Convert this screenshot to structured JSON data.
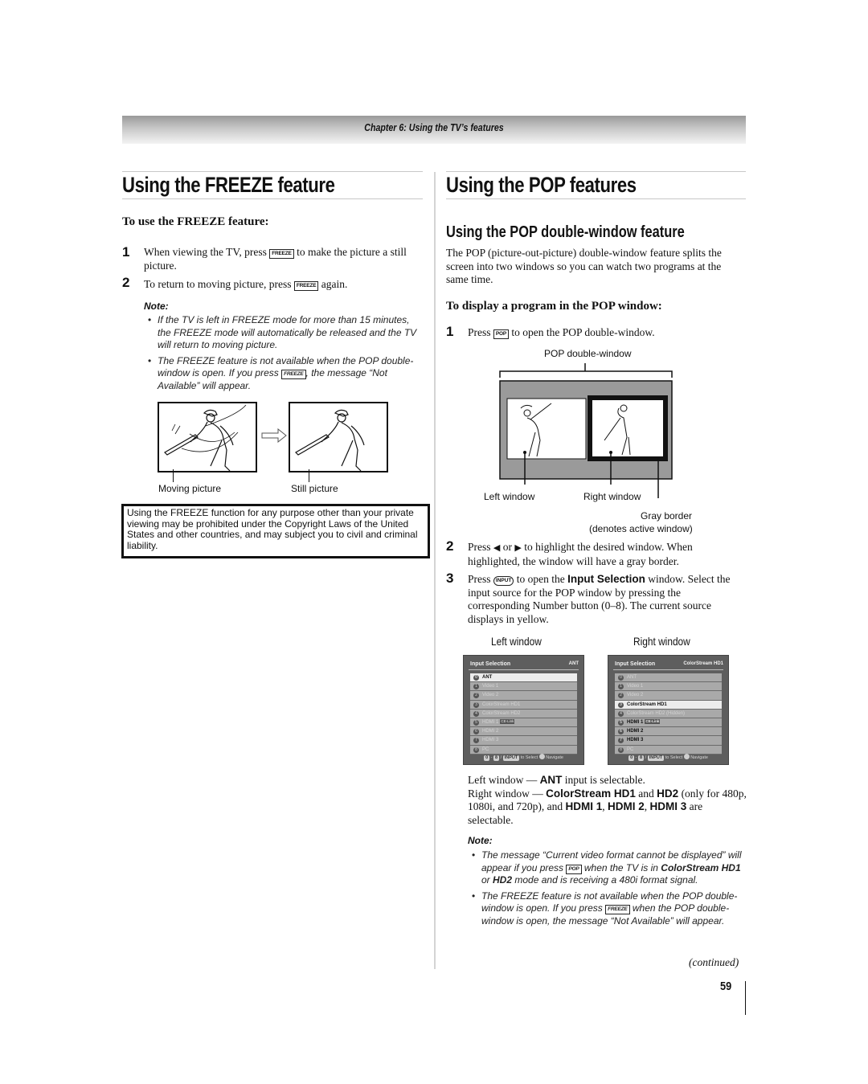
{
  "header": {
    "chapter": "Chapter 6: Using the TV’s features"
  },
  "left": {
    "title": "Using the FREEZE feature",
    "subhead": "To use the FREEZE feature:",
    "steps": [
      {
        "num": "1",
        "pre": "When viewing the TV, press",
        "key": "FREEZE",
        "post": "to make the picture a still picture."
      },
      {
        "num": "2",
        "pre": "To return to moving picture, press",
        "key": "FREEZE",
        "post": "again."
      }
    ],
    "note_title": "Note:",
    "notes": [
      {
        "text": "If the TV is left in FREEZE mode for more than 15 minutes, the FREEZE mode will automatically be released and the TV will return to moving picture."
      },
      {
        "pre": "The FREEZE feature is not available when the POP double-window is open. If you press",
        "key": "FREEZE",
        "post": ", the message “Not Available” will appear."
      }
    ],
    "figure": {
      "moving_label": "Moving picture",
      "still_label": "Still picture"
    },
    "warning": "Using the FREEZE function for any purpose other than your private viewing may be prohibited under the Copyright Laws of the United States and other countries, and may subject you to civil and criminal liability."
  },
  "right": {
    "title": "Using the POP features",
    "subtitle": "Using the POP double-window feature",
    "intro": "The POP (picture-out-picture) double-window feature splits the screen into two windows so you can watch two programs at the same time.",
    "subhead": "To display a program in the POP window:",
    "step1": {
      "num": "1",
      "pre": "Press",
      "key": "POP",
      "post": "to open the POP double-window."
    },
    "diagram": {
      "top_label": "POP double-window",
      "left_label": "Left window",
      "right_label": "Right window",
      "border_label_1": "Gray border",
      "border_label_2": "(denotes active window)"
    },
    "step2": {
      "num": "2",
      "pre": "Press",
      "left_arrow": "◀",
      "mid": "or",
      "right_arrow": "▶",
      "post": "to highlight the desired window. When highlighted, the window will have a gray border."
    },
    "step3": {
      "num": "3",
      "pre": "Press",
      "key": "INPUT",
      "mid": "to open the",
      "bold": "Input Selection",
      "post": "window. Select the input source for the POP window by pressing the corresponding Number button (0–8). The current source displays in yellow."
    },
    "panel_labels": {
      "left": "Left window",
      "right": "Right window"
    },
    "panels": [
      {
        "title": "Input Selection",
        "current": "ANT",
        "items": [
          {
            "num": "0",
            "label": "ANT",
            "state": "sel"
          },
          {
            "num": "1",
            "label": "Video 1",
            "state": "dim"
          },
          {
            "num": "2",
            "label": "Video 2",
            "state": "dim"
          },
          {
            "num": "3",
            "label": "ColorStream HD1",
            "state": "dim"
          },
          {
            "num": "4",
            "label": "ColorStream HD2",
            "state": "dim"
          },
          {
            "num": "5",
            "label": "HDMI 1",
            "tag": "CE-Link",
            "state": "dim"
          },
          {
            "num": "6",
            "label": "HDMI 2",
            "state": "dim"
          },
          {
            "num": "7",
            "label": "HDMI 3",
            "state": "dim"
          },
          {
            "num": "8",
            "label": "PC",
            "state": "dim"
          }
        ],
        "footer": {
          "k0": "0",
          "dash": "-",
          "k8": "8",
          "slash": "/",
          "input": "INPUT",
          "select": "to Select",
          "navigate": "Navigate"
        }
      },
      {
        "title": "Input Selection",
        "current": "ColorStream HD1",
        "items": [
          {
            "num": "0",
            "label": "ANT",
            "state": "dim"
          },
          {
            "num": "1",
            "label": "Video 1",
            "state": "dim"
          },
          {
            "num": "2",
            "label": "Video 2",
            "state": "dim"
          },
          {
            "num": "3",
            "label": "ColorStream HD1",
            "state": "sel"
          },
          {
            "num": "4",
            "label": "ColorStream HD2 (Hidden)",
            "state": "dim"
          },
          {
            "num": "5",
            "label": "HDMI 1",
            "tag": "CE-Link",
            "state": "on"
          },
          {
            "num": "6",
            "label": "HDMI 2",
            "state": "on"
          },
          {
            "num": "7",
            "label": "HDMI 3",
            "state": "on"
          },
          {
            "num": "8",
            "label": "PC",
            "state": "dim"
          }
        ],
        "footer": {
          "k0": "0",
          "dash": "-",
          "k8": "8",
          "slash": "/",
          "input": "INPUT",
          "select": "to Select",
          "navigate": "Navigate"
        }
      }
    ],
    "selectable": {
      "line1_pre": "Left window — ",
      "line1_bold": "ANT",
      "line1_post": " input is selectable.",
      "line2_pre": "Right window — ",
      "b1": "ColorStream HD1",
      "t1": " and ",
      "b2": "HD2",
      "t2": " (only for 480p, 1080i, and 720p), and ",
      "b3": "HDMI 1",
      "t3": ", ",
      "b4": "HDMI 2",
      "t4": ", ",
      "b5": "HDMI 3",
      "t5": " are selectable."
    },
    "note_title": "Note:",
    "notes": [
      {
        "pre": "The message “Current video format cannot be displayed” will appear if you press",
        "key": "POP",
        "mid": "when the TV is in",
        "b1": "ColorStream HD1",
        "or": "or",
        "b2": "HD2",
        "post": "mode and is receiving a 480i format signal."
      },
      {
        "pre": "The FREEZE feature is not available when the POP double-window is open. If you press",
        "key": "FREEZE",
        "post": "when the POP double-window is open, the message “Not Available” will appear."
      }
    ],
    "continued": "(continued)"
  },
  "footer": {
    "page_number": "59"
  }
}
